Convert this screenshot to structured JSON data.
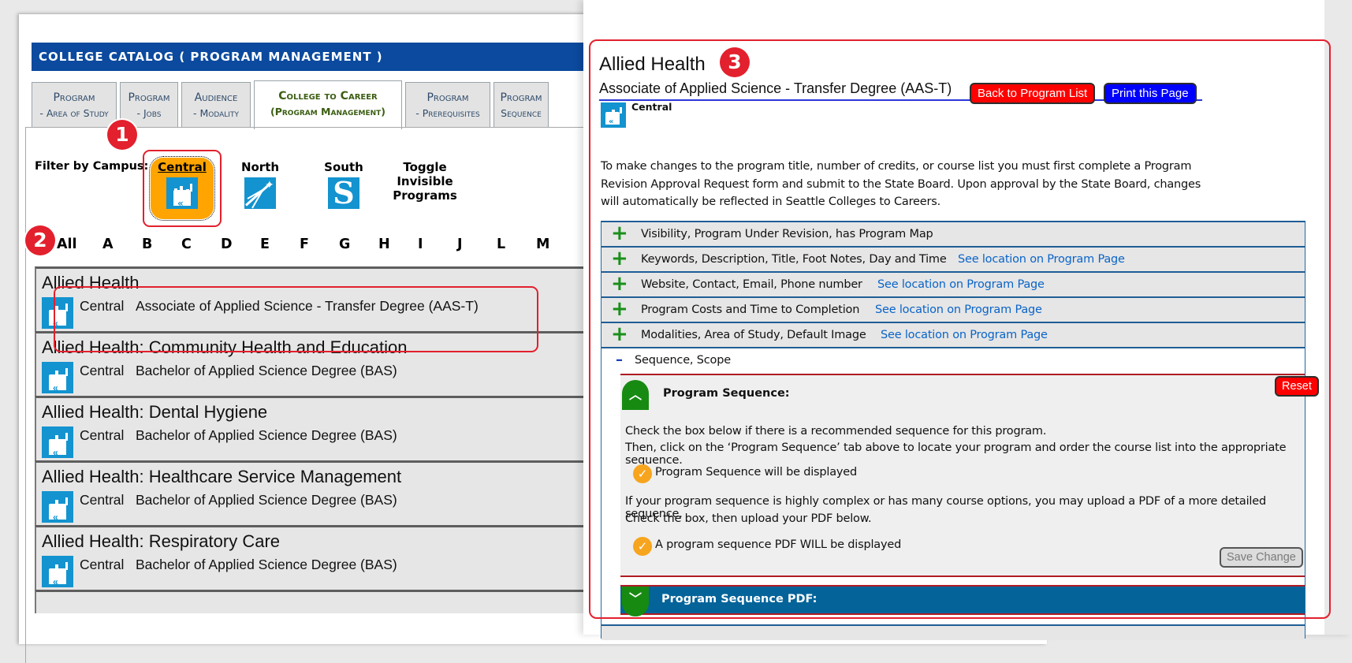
{
  "left": {
    "header_title": "COLLEGE CATALOG ( PROGRAM MANAGEMENT )",
    "tabs": [
      {
        "line1": "Program",
        "line2": "- Area of Study",
        "active": false
      },
      {
        "line1": "Program",
        "line2": "- Jobs",
        "active": false
      },
      {
        "line1": "Audience",
        "line2": "- Modality",
        "active": false
      },
      {
        "line1": "College to Career",
        "line2": "(Program Management)",
        "active": true
      },
      {
        "line1": "Program",
        "line2": "- Prerequisites",
        "active": false
      },
      {
        "line1": "Program",
        "line2": "Sequence",
        "active": false
      }
    ],
    "filter_label": "Filter by Campus:",
    "campuses": {
      "central": "Central",
      "north": "North",
      "south": "South",
      "toggle_line1": "Toggle",
      "toggle_line2": "Invisible",
      "toggle_line3": "Programs"
    },
    "selected_campus": "Central",
    "letters": [
      "All",
      "A",
      "B",
      "C",
      "D",
      "E",
      "F",
      "G",
      "H",
      "I",
      "J",
      "L",
      "M"
    ],
    "programs": [
      {
        "name": "Allied Health",
        "campus": "Central",
        "degree": "Associate of Applied Science - Transfer Degree (AAS-T)"
      },
      {
        "name": "Allied Health: Community Health and Education",
        "campus": "Central",
        "degree": "Bachelor of Applied Science Degree (BAS)"
      },
      {
        "name": "Allied Health: Dental Hygiene",
        "campus": "Central",
        "degree": "Bachelor of Applied Science Degree (BAS)"
      },
      {
        "name": "Allied Health: Healthcare Service Management",
        "campus": "Central",
        "degree": "Bachelor of Applied Science Degree (BAS)"
      },
      {
        "name": "Allied Health: Respiratory Care",
        "campus": "Central",
        "degree": "Bachelor of Applied Science Degree (BAS)"
      }
    ]
  },
  "annotations": {
    "step1": "1",
    "step2": "2",
    "step3": "3"
  },
  "right": {
    "title": "Allied Health",
    "subtitle": "Associate of Applied Science - Transfer Degree (AAS-T)",
    "back_button": "Back to Program List",
    "print_button": "Print this Page",
    "campus": "Central",
    "notice": "To make changes to the program title, number of credits, or course list you must first complete a Program Revision Approval Request form and submit to the State Board. Upon approval by the State Board, changes will automatically be reflected in Seattle Colleges to Careers.",
    "sections": [
      {
        "label": "Visibility, Program Under Revision, has Program Map",
        "link": ""
      },
      {
        "label": "Keywords, Description, Title, Foot Notes, Day and Time",
        "link": "See location on Program Page"
      },
      {
        "label": "Website, Contact, Email, Phone number",
        "link": "See location on Program Page"
      },
      {
        "label": "Program Costs and Time to Completion",
        "link": "See location on Program Page"
      },
      {
        "label": "Modalities, Area of Study, Default Image",
        "link": "See location on Program Page"
      }
    ],
    "open_section": {
      "label": "Sequence, Scope",
      "program_sequence_title": "Program Sequence:",
      "reset_button": "Reset",
      "instruction1": "Check the box below if there is a recommended sequence for this program.",
      "instruction2": "Then, click on the ‘Program Sequence’ tab above to locate your program and order the course list into the appropriate sequence.",
      "checkbox1_label": "Program Sequence will be displayed",
      "checkbox1_checked": true,
      "instruction3": "If your program sequence is highly complex or has many course options, you may upload a PDF of a more detailed sequence.",
      "instruction4": "Check the box, then upload your PDF below.",
      "checkbox2_label": "A program sequence PDF WILL be displayed",
      "checkbox2_checked": true,
      "save_button": "Save Change",
      "pdf_section_title": "Program Sequence PDF:"
    }
  },
  "colors": {
    "header_blue": "#0b4a9e",
    "annotation_red": "#e3202d",
    "campus_selected": "#ffa400",
    "campus_logo_blue": "#1393cf",
    "accordion_plus_green": "#1a8f1a",
    "link_blue": "#0a64c8",
    "pdf_bar_blue": "#04649a"
  }
}
